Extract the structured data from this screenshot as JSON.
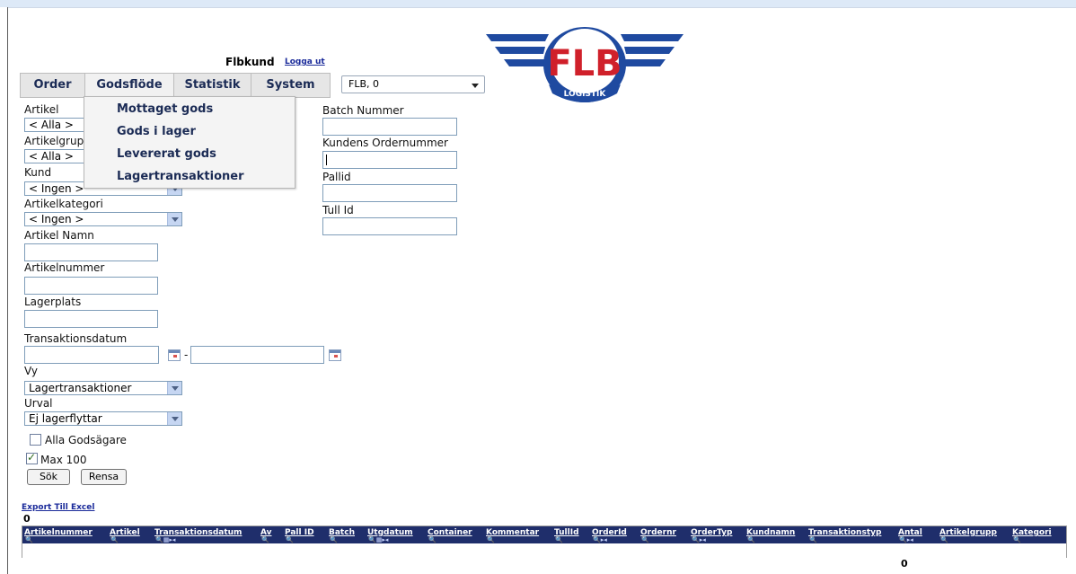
{
  "header": {
    "user": "Flbkund",
    "logout": "Logga ut",
    "logo_text": "FLB",
    "logo_sub": "LOGISTIK",
    "customer_select": "FLB, 0"
  },
  "menu": {
    "items": [
      "Order",
      "Godsflöde",
      "Statistik",
      "System"
    ],
    "dropdown": [
      "Mottaget gods",
      "Gods i lager",
      "Levererat gods",
      "Lagertransaktioner"
    ]
  },
  "filters": {
    "artikel_label": "Artikel",
    "artikel_value": "< Alla >",
    "artikelgrupp_label": "Artikelgrupp",
    "artikelgrupp_value": "< Alla >",
    "kund_label": "Kund",
    "kund_value": "< Ingen >",
    "artikelkategori_label": "Artikelkategori",
    "artikelkategori_value": "< Ingen >",
    "artikelnamn_label": "Artikel Namn",
    "artikelnummer_label": "Artikelnummer",
    "lagerplats_label": "Lagerplats",
    "transaktionsdatum_label": "Transaktionsdatum",
    "date_separator": "-",
    "vy_label": "Vy",
    "vy_value": "Lagertransaktioner",
    "urval_label": "Urval",
    "urval_value": "Ej lagerflyttar",
    "alla_godsagare": "Alla Godsägare",
    "alla_godsagare_checked": false,
    "max100": "Max 100",
    "max100_checked": true,
    "search_button": "Sök",
    "clear_button": "Rensa"
  },
  "right_filters": {
    "batch_label": "Batch Nummer",
    "kundens_order_label": "Kundens Ordernummer",
    "pallid_label": "Pallid",
    "tullid_label": "Tull Id"
  },
  "results": {
    "export": "Export Till Excel",
    "count": "0",
    "columns": [
      "Artikelnummer",
      "Artikel",
      "Transaktionsdatum",
      "Av",
      "Pall ID",
      "Batch",
      "Utgdatum",
      "Container",
      "Kommentar",
      "TullId",
      "OrderId",
      "Ordernr",
      "OrderTyp",
      "Kundnamn",
      "Transaktionstyp",
      "Antal",
      "Artikelgrupp",
      "Kategori"
    ],
    "antal_total": "0"
  },
  "colors": {
    "accent": "#1f2e6b",
    "logo_red": "#d0202a",
    "logo_blue": "#1f4aa0"
  }
}
